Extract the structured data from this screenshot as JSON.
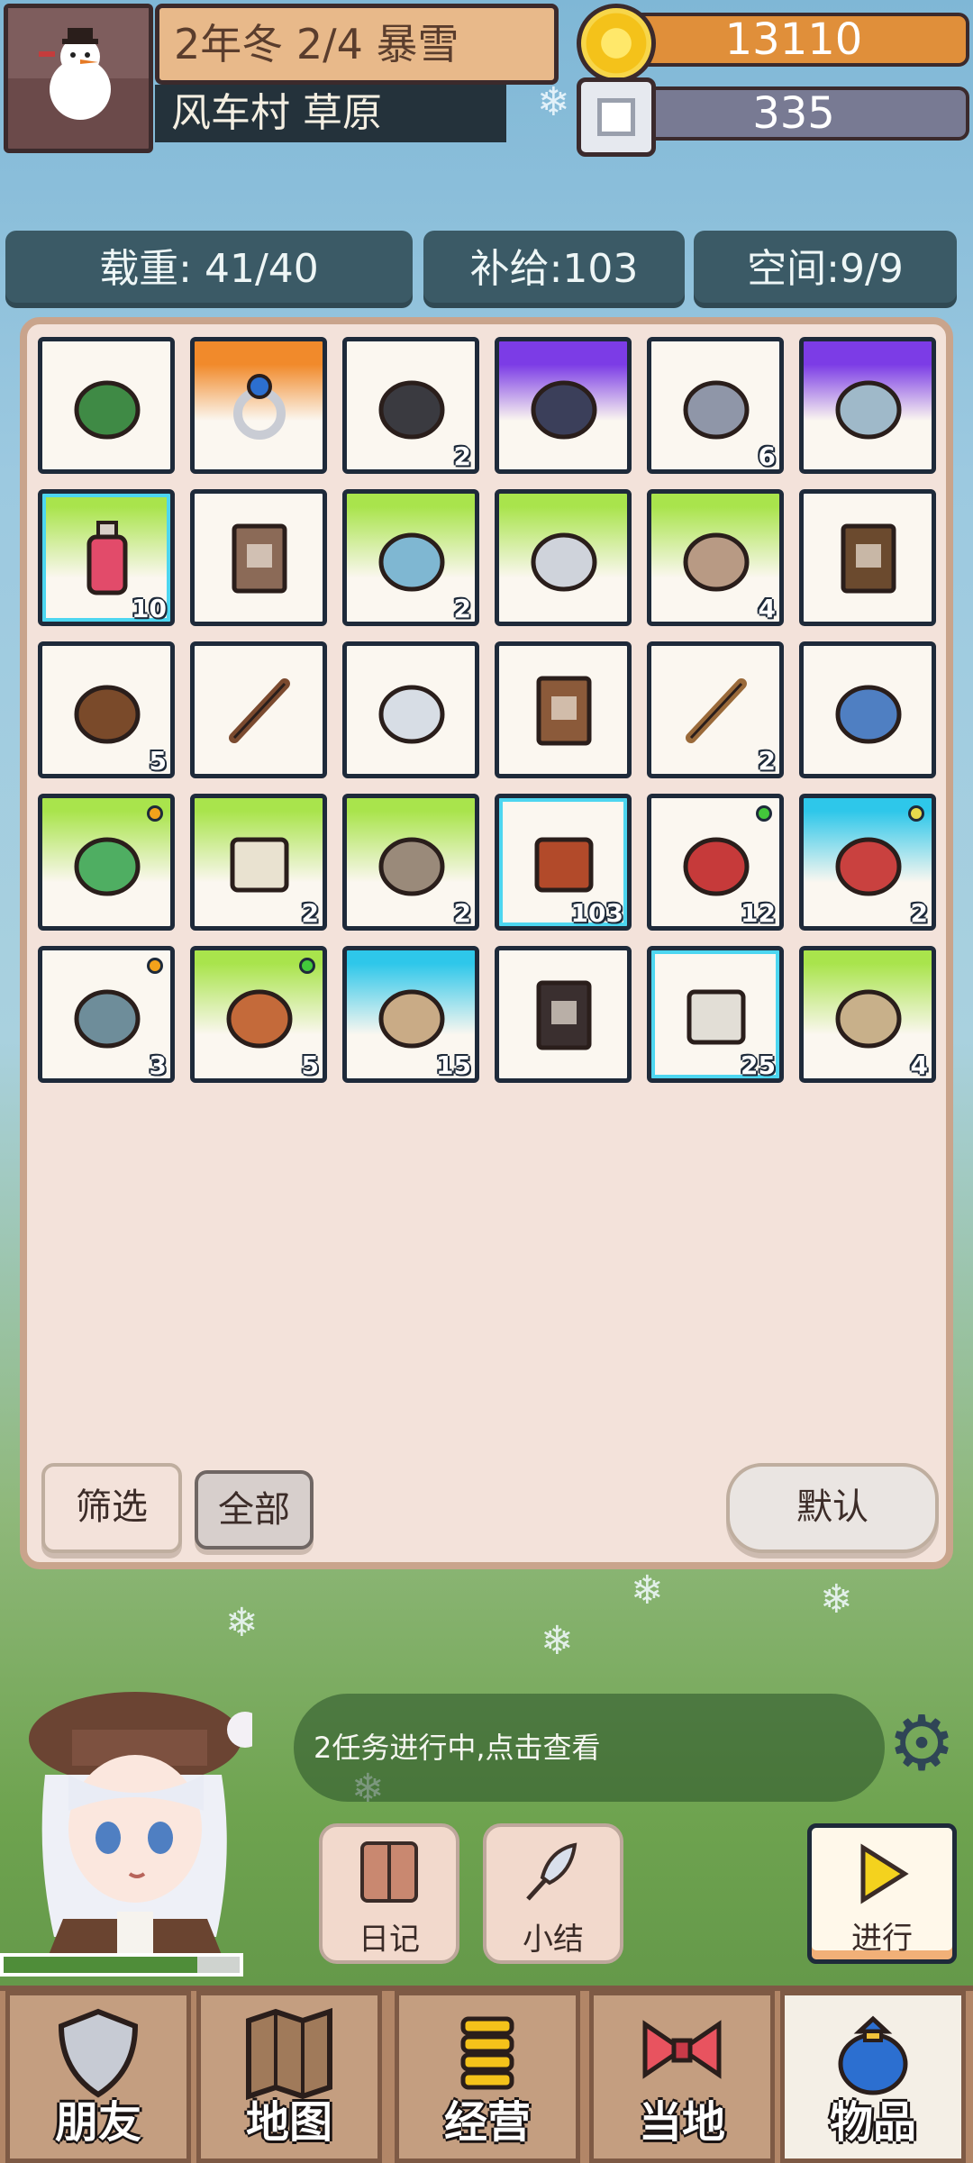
{
  "header": {
    "date": "2年冬 2/4 暴雪",
    "location": "风车村 草原",
    "gold": "13110",
    "silver": "335"
  },
  "stats": {
    "weight": "载重: 41/40",
    "supply": "补给:103",
    "space": "空间:9/9"
  },
  "inventory": {
    "slots": [
      {
        "icon": "clover-icon",
        "count": "",
        "bg": "plain"
      },
      {
        "icon": "ring-icon",
        "count": "",
        "bg": "orange"
      },
      {
        "icon": "coal-icon",
        "count": "2",
        "bg": "plain"
      },
      {
        "icon": "dark-gem-icon",
        "count": "",
        "bg": "purple"
      },
      {
        "icon": "ore-pickaxe-icon",
        "count": "6",
        "bg": "plain"
      },
      {
        "icon": "crystal-ore-icon",
        "count": "",
        "bg": "purple"
      },
      {
        "icon": "potion-icon",
        "count": "10",
        "bg": "green"
      },
      {
        "icon": "skull-book-icon",
        "count": "",
        "bg": "plain"
      },
      {
        "icon": "crystal-shard-icon",
        "count": "2",
        "bg": "green"
      },
      {
        "icon": "armor-icon",
        "count": "",
        "bg": "green"
      },
      {
        "icon": "rune-stone-icon",
        "count": "4",
        "bg": "green"
      },
      {
        "icon": "rose-book-icon",
        "count": "",
        "bg": "plain"
      },
      {
        "icon": "dung-icon",
        "count": "5",
        "bg": "plain"
      },
      {
        "icon": "branch-icon",
        "count": "",
        "bg": "plain"
      },
      {
        "icon": "feather-icon",
        "count": "",
        "bg": "plain"
      },
      {
        "icon": "brown-book-icon",
        "count": "",
        "bg": "plain"
      },
      {
        "icon": "sword-icon",
        "count": "2",
        "bg": "plain"
      },
      {
        "icon": "blue-leaf-icon",
        "count": "",
        "bg": "plain"
      },
      {
        "icon": "herb-icon",
        "count": "",
        "bg": "green",
        "dot": "#f2a21b"
      },
      {
        "icon": "scroll-paper-icon",
        "count": "2",
        "bg": "green"
      },
      {
        "icon": "blue-rune-icon",
        "count": "2",
        "bg": "green"
      },
      {
        "icon": "ration-icon",
        "count": "103",
        "bg": "plain"
      },
      {
        "icon": "meat-leg-icon",
        "count": "12",
        "bg": "plain",
        "dot": "#43c83b"
      },
      {
        "icon": "steak-icon",
        "count": "2",
        "bg": "cyan",
        "dot": "#e7d94c"
      },
      {
        "icon": "fish-icon",
        "count": "3",
        "bg": "plain",
        "dot": "#f2a21b"
      },
      {
        "icon": "pot-icon",
        "count": "5",
        "bg": "green",
        "dot": "#43c83b"
      },
      {
        "icon": "bandage-icon",
        "count": "15",
        "bg": "cyan"
      },
      {
        "icon": "pentagram-book-icon",
        "count": "",
        "bg": "plain"
      },
      {
        "icon": "medkit-icon",
        "count": "25",
        "bg": "plain"
      },
      {
        "icon": "horn-icon",
        "count": "4",
        "bg": "green"
      }
    ]
  },
  "panel_buttons": {
    "filter": "筛选",
    "all": "全部",
    "default": "默认"
  },
  "quest_text": "2任务进行中,点击查看",
  "actions": {
    "diary": "日记",
    "summary": "小结",
    "proceed": "进行"
  },
  "nav": {
    "friends": "朋友",
    "map": "地图",
    "business": "经营",
    "local": "当地",
    "items": "物品"
  },
  "health_fraction": 0.82,
  "colors": {
    "gold": "#e08f3a",
    "silver": "#787a93",
    "stat_bg": "#3b5a66",
    "panel": "#f3e2da"
  }
}
